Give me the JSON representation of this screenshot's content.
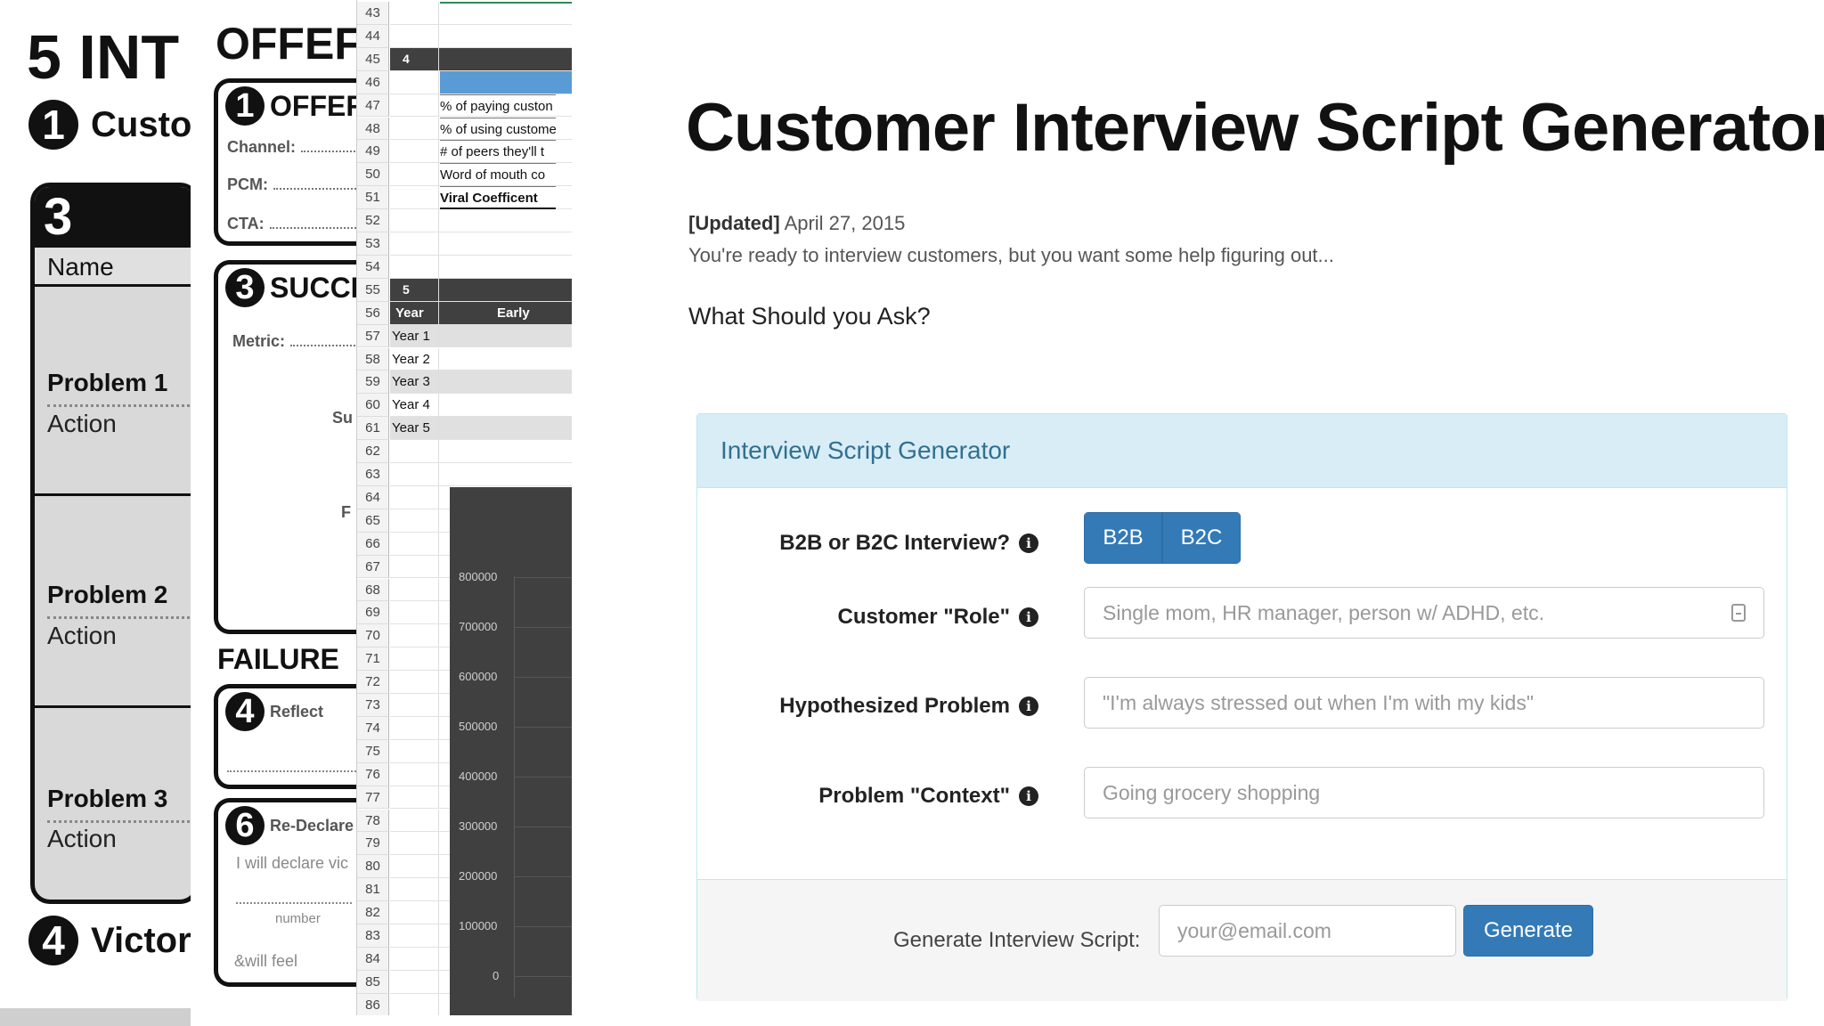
{
  "worksheet": {
    "title": "5 INT",
    "section1": {
      "num": "1",
      "label": "Custo"
    },
    "section3": {
      "num": "3",
      "name_label": "Name"
    },
    "problems": [
      {
        "title": "Problem 1",
        "action": "Action"
      },
      {
        "title": "Problem 2",
        "action": "Action"
      },
      {
        "title": "Problem 3",
        "action": "Action"
      }
    ],
    "section4": {
      "num": "4",
      "label": "Victor"
    },
    "offer_title": "OFFEF",
    "offer_card": {
      "num": "1",
      "title": "OFFEF",
      "channel": "Channel:",
      "pcm": "PCM:",
      "cta": "CTA:"
    },
    "success_card": {
      "num": "3",
      "title": "SUCCE",
      "metric": "Metric:",
      "su": "Su",
      "f": "F"
    },
    "failure_title": "FAILURE",
    "reflect_card": {
      "num": "4",
      "label": "Reflect"
    },
    "redeclare_card": {
      "num": "6",
      "label": "Re-Declare",
      "line1": "I will declare vic",
      "number": "number",
      "feel": "&will feel"
    }
  },
  "spreadsheet": {
    "row_numbers": [
      "43",
      "44",
      "45",
      "46",
      "47",
      "48",
      "49",
      "50",
      "51",
      "52",
      "53",
      "54",
      "55",
      "56",
      "57",
      "58",
      "59",
      "60",
      "61",
      "62",
      "63",
      "64",
      "65",
      "66",
      "67",
      "68",
      "69",
      "70",
      "71",
      "72",
      "73",
      "74",
      "75",
      "76",
      "77",
      "78",
      "79",
      "80",
      "81",
      "82",
      "83",
      "84",
      "85",
      "86"
    ],
    "section4_label": "4",
    "metrics": [
      "% of paying custon",
      "% of using custome",
      "# of peers they'll t",
      "Word of mouth co",
      "Viral Coefficent"
    ],
    "section5_label": "5",
    "year_header": "Year",
    "early_header": "Early",
    "years": [
      "Year 1",
      "Year 2",
      "Year 3",
      "Year 4",
      "Year 5"
    ],
    "chart_ticks": [
      "800000",
      "700000",
      "600000",
      "500000",
      "400000",
      "300000",
      "200000",
      "100000",
      "0"
    ]
  },
  "app": {
    "title": "Customer Interview Script Generator",
    "updated_tag": "[Updated]",
    "updated_date": "April 27, 2015",
    "lead": "You're ready to interview customers, but you want some help figuring out...",
    "question": "What Should you Ask?",
    "panel_title": "Interview Script Generator",
    "fields": {
      "type_label": "B2B or B2C Interview?",
      "type_options": [
        "B2B",
        "B2C"
      ],
      "role_label": "Customer \"Role\"",
      "role_placeholder": "Single mom, HR manager, person w/ ADHD, etc.",
      "problem_label": "Hypothesized Problem",
      "problem_placeholder": "\"I'm always stressed out when I'm with my kids\"",
      "context_label": "Problem \"Context\"",
      "context_placeholder": "Going grocery shopping"
    },
    "footer": {
      "label": "Generate Interview Script:",
      "email_placeholder": "your@email.com",
      "button": "Generate"
    },
    "colors": {
      "primary": "#337ab7",
      "panel_head": "#d9edf7",
      "panel_text": "#31708f"
    }
  }
}
